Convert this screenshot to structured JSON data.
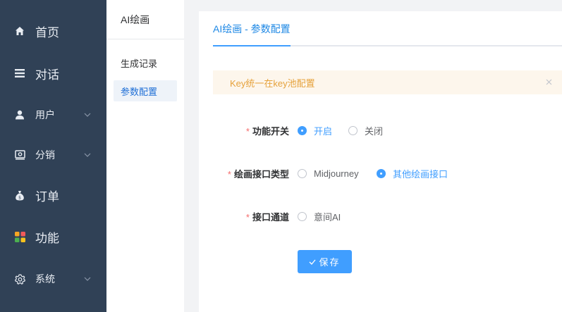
{
  "sidebar": {
    "bg": "#304156",
    "items": [
      {
        "label": "首页",
        "icon": "home-icon",
        "size": "big",
        "chevron": false
      },
      {
        "label": "对话",
        "icon": "list-icon",
        "size": "big",
        "chevron": false
      },
      {
        "label": "用户",
        "icon": "user-icon",
        "size": "small",
        "chevron": true
      },
      {
        "label": "分销",
        "icon": "distribution-icon",
        "size": "small",
        "chevron": true
      },
      {
        "label": "订单",
        "icon": "money-bag-icon",
        "size": "big",
        "chevron": false
      },
      {
        "label": "功能",
        "icon": "grid-icon",
        "size": "big",
        "chevron": false
      },
      {
        "label": "系统",
        "icon": "gear-icon",
        "size": "small",
        "chevron": true
      }
    ]
  },
  "submenu": {
    "title": "AI绘画",
    "items": [
      {
        "label": "生成记录",
        "active": false
      },
      {
        "label": "参数配置",
        "active": true
      }
    ]
  },
  "main": {
    "tab_label": "AI绘画 - 参数配置",
    "alert_text": "Key统一在key池配置",
    "alert_close": "×",
    "form": {
      "feature_switch": {
        "label": "功能开关",
        "required_mark": "*",
        "options": [
          {
            "label": "开启",
            "checked": true
          },
          {
            "label": "关闭",
            "checked": false
          }
        ]
      },
      "api_type": {
        "label": "绘画接口类型",
        "required_mark": "*",
        "options": [
          {
            "label": "Midjourney",
            "checked": false
          },
          {
            "label": "其他绘画接口",
            "checked": true
          }
        ]
      },
      "api_channel": {
        "label": "接口通道",
        "required_mark": "*",
        "options": [
          {
            "label": "意间AI",
            "checked": false
          }
        ]
      }
    },
    "save_label": "保存"
  },
  "colors": {
    "primary": "#409eff",
    "warning_bg": "#fdf6ec",
    "warning_text": "#e6a23c",
    "required": "#f56c6c"
  }
}
